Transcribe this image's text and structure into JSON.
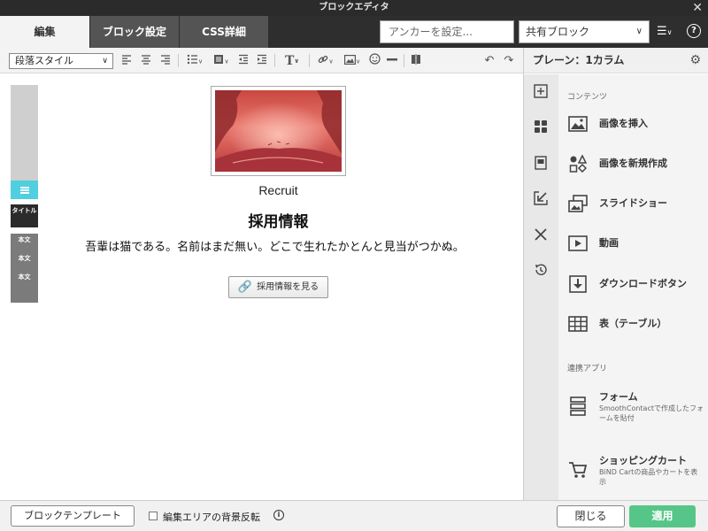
{
  "window": {
    "title": "ブロックエディタ",
    "close_icon": "close-icon"
  },
  "tabs": [
    {
      "label": "編集",
      "active": true
    },
    {
      "label": "ブロック設定",
      "active": false
    },
    {
      "label": "CSS詳細",
      "active": false
    }
  ],
  "anchor": {
    "placeholder": "アンカーを設定..."
  },
  "shared_block": {
    "value": "共有ブロック"
  },
  "toolbar": {
    "paragraph_style": "段落スタイル",
    "icons": [
      "align-left-icon",
      "align-center-icon",
      "align-right-icon",
      "bullet-list-icon",
      "block-format-icon",
      "outdent-icon",
      "indent-icon",
      "text-style-icon",
      "link-icon",
      "image-icon",
      "emoji-icon",
      "horizontal-rule-icon",
      "columns-icon",
      "undo-icon",
      "redo-icon"
    ]
  },
  "editor": {
    "rail": {
      "title_label": "タイトル",
      "body_labels": [
        "本文",
        "本文",
        "本文"
      ]
    },
    "image_alt": "Recruit header image",
    "caption": "Recruit",
    "heading": "採用情報",
    "body": "吾輩は猫である。名前はまだ無い。どこで生れたかとんと見当がつかぬ。",
    "button_label": "採用情報を見る"
  },
  "panel": {
    "title": "プレーン：1カラム",
    "sections": [
      {
        "label": "コンテンツ",
        "items": [
          {
            "label": "画像を挿入",
            "icon": "image-icon"
          },
          {
            "label": "画像を新規作成",
            "icon": "shapes-icon"
          },
          {
            "label": "スライドショー",
            "icon": "slideshow-icon"
          },
          {
            "label": "動画",
            "icon": "video-icon"
          },
          {
            "label": "ダウンロードボタン",
            "icon": "download-icon"
          },
          {
            "label": "表（テーブル）",
            "icon": "table-icon"
          }
        ]
      },
      {
        "label": "連携アプリ",
        "items": [
          {
            "label": "フォーム",
            "description": "SmoothContactで作成したフォームを貼付",
            "icon": "form-icon"
          },
          {
            "label": "ショッピングカート",
            "description": "BiND Cartの商品やカートを表示",
            "icon": "cart-icon"
          }
        ]
      }
    ]
  },
  "footer": {
    "template_button": "ブロックテンプレート",
    "checkbox_label": "編集エリアの背景反転",
    "checkbox_checked": false,
    "close_button": "閉じる",
    "apply_button": "適用"
  },
  "colors": {
    "accent": "#55c687",
    "rail_active": "#4fcfdf",
    "dark": "#2b2b2b"
  }
}
